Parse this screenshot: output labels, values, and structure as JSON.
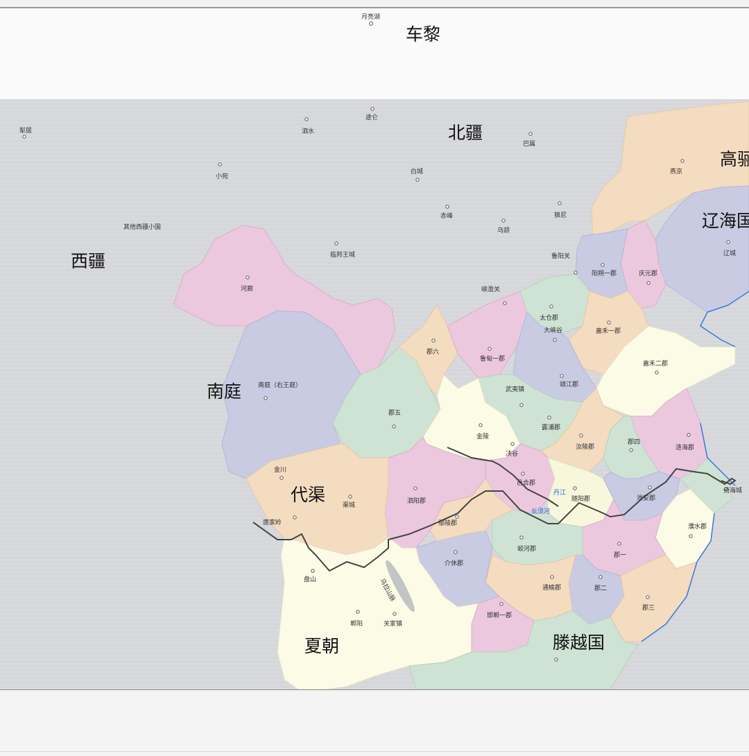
{
  "top_labels": {
    "moon_lake": "月亮湖",
    "cheli": "车黎"
  },
  "regions": {
    "xijiang": "西疆",
    "beijiang": "北疆",
    "gaoli": "高骊",
    "liaohaiguo": "辽海国",
    "nanting": "南庭",
    "daiqu": "代渠",
    "xiachao": "夏朝",
    "tengyueguo": "滕越国"
  },
  "cities": {
    "liju": "犁居",
    "sishui": "泗水",
    "tulun": "途仑",
    "bashu": "巴属",
    "xiaowan": "小宛",
    "baicheng": "白城",
    "chifeng": "赤峰",
    "langni": "狼尼",
    "wuyu": "乌颉",
    "qitaxijiang": "其他西疆小国",
    "linbang": "临邦王城",
    "luyangguan": "鲁阳关",
    "helang": "河廊",
    "xiamanguan": "峡澹关",
    "yanjing": "燕京",
    "liaocheng": "辽城",
    "yangshuoyi": "阳朔一郡",
    "qingyuan": "庆元郡",
    "taicang": "太仓郡",
    "daxiagu": "大峡谷",
    "jiahe1": "嘉禾一郡",
    "junliu": "郡六",
    "ludian1": "鲁甸一郡",
    "jiahe2": "嘉禾二郡",
    "jingjiang": "靖江郡",
    "nanting_city": "南庭（右王庭）",
    "wuyi": "武夷镇",
    "junwu": "郡五",
    "jinling": "金陵",
    "lupu": "露浦郡",
    "lianghai": "涟海郡",
    "ruling": "汝陵郡",
    "junsi": "郡四",
    "juegu": "决谷",
    "jinchuan": "金川",
    "yihe": "邑合郡",
    "suiyang": "随阳郡",
    "yian": "泄安郡",
    "yihaicheng": "倚海城",
    "qucheng": "渠城",
    "siyang": "泗阳郡",
    "tangjialing": "唐家岭",
    "yanling": "鄢陵郡",
    "jiaohe": "蛟河郡",
    "pushui": "濮水郡",
    "junyi": "郡一",
    "panshan": "盘山",
    "jiexiu": "介休郡",
    "tongyu": "通榆郡",
    "juner": "郡二",
    "junsan": "郡三",
    "handu1": "邯郸一郡",
    "yunyang": "郸阳",
    "guanjia": "关家镇",
    "wulashan": "乌拉山脉"
  },
  "rivers": {
    "danjiang": "丹江",
    "changxu": "长须河"
  },
  "colors": {
    "sea": "#d7d8dc",
    "pink": "#ecc8df",
    "lavender": "#c9cbe3",
    "mint": "#cfe3d5",
    "peach": "#f4dcc0",
    "cream": "#fbfbe6",
    "cream2": "#f7f7dc",
    "coast": "#3a78d8",
    "border": "#c9a0a0",
    "route": "#444444"
  }
}
